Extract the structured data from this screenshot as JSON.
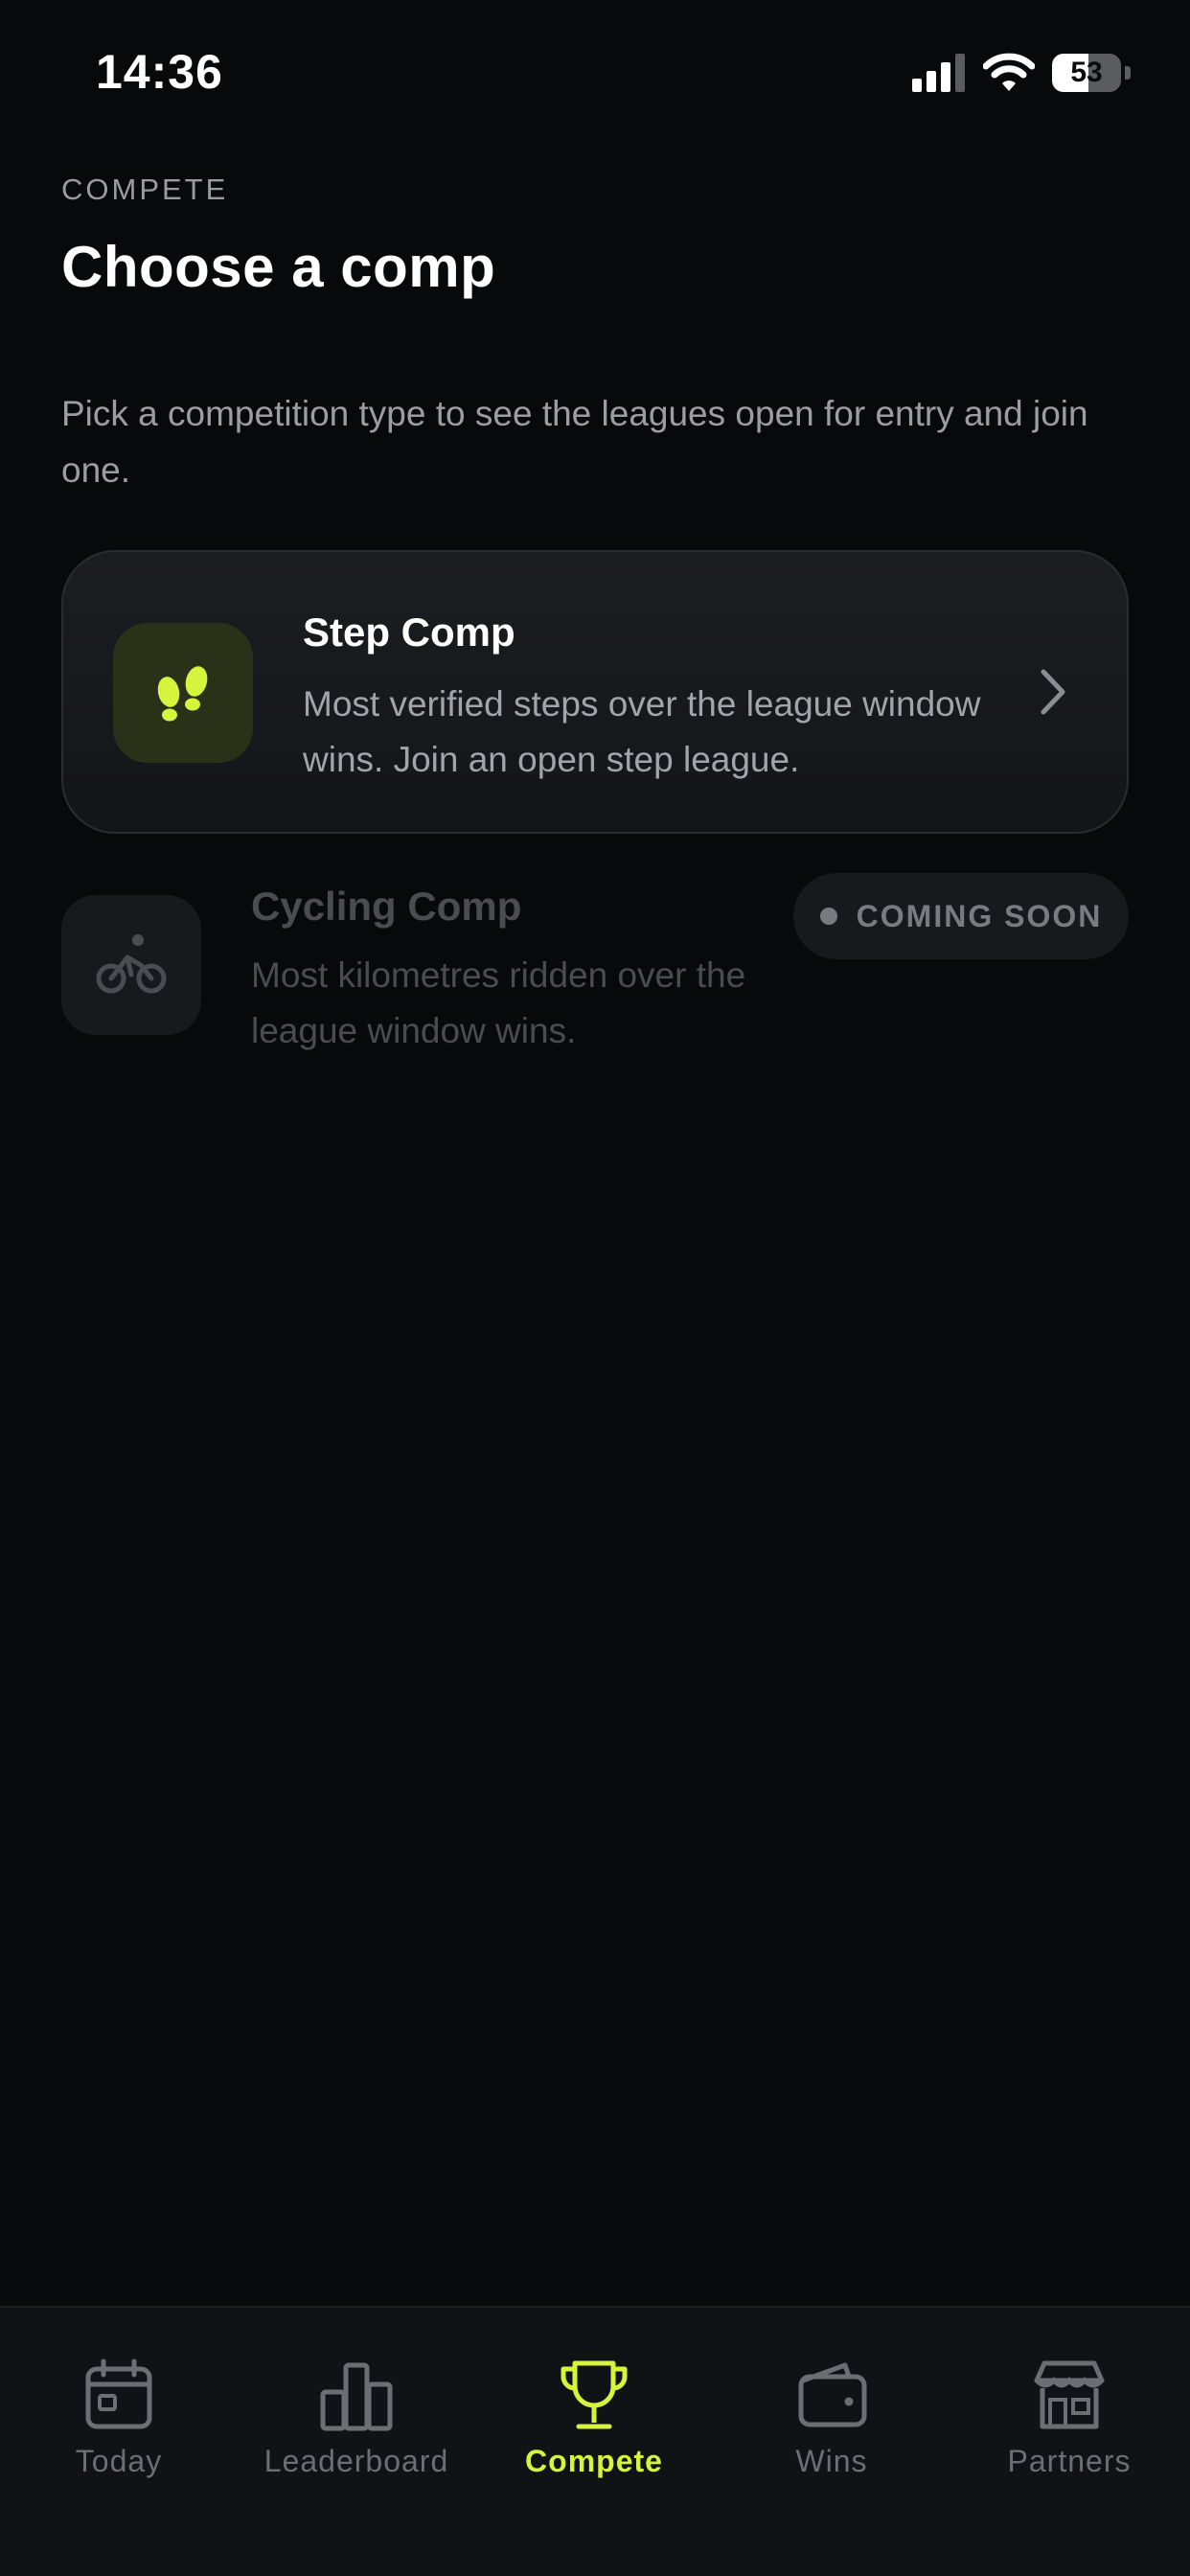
{
  "status_bar": {
    "time": "14:36",
    "battery_level": "53",
    "icons": [
      "cellular-signal-icon",
      "wifi-icon",
      "battery-icon"
    ]
  },
  "header": {
    "eyebrow": "COMPETE",
    "title": "Choose a comp",
    "intro": "Pick a competition type to see the leagues open for entry and join one."
  },
  "comps": {
    "step": {
      "title": "Step Comp",
      "description": "Most verified steps over the league window wins. Join an open step league.",
      "icon": "footprints-icon"
    },
    "cycling": {
      "title": "Cycling Comp",
      "description": "Most kilometres ridden over the league window wins.",
      "badge": "COMING SOON",
      "icon": "cyclist-icon"
    }
  },
  "tabs": {
    "today": "Today",
    "leaderboard": "Leaderboard",
    "compete": "Compete",
    "wins": "Wins",
    "partners": "Partners"
  },
  "colors": {
    "accent": "#d6f43c",
    "background": "#08090b",
    "muted_text": "#9c9da2",
    "inactive_tab": "#6d6e73"
  }
}
